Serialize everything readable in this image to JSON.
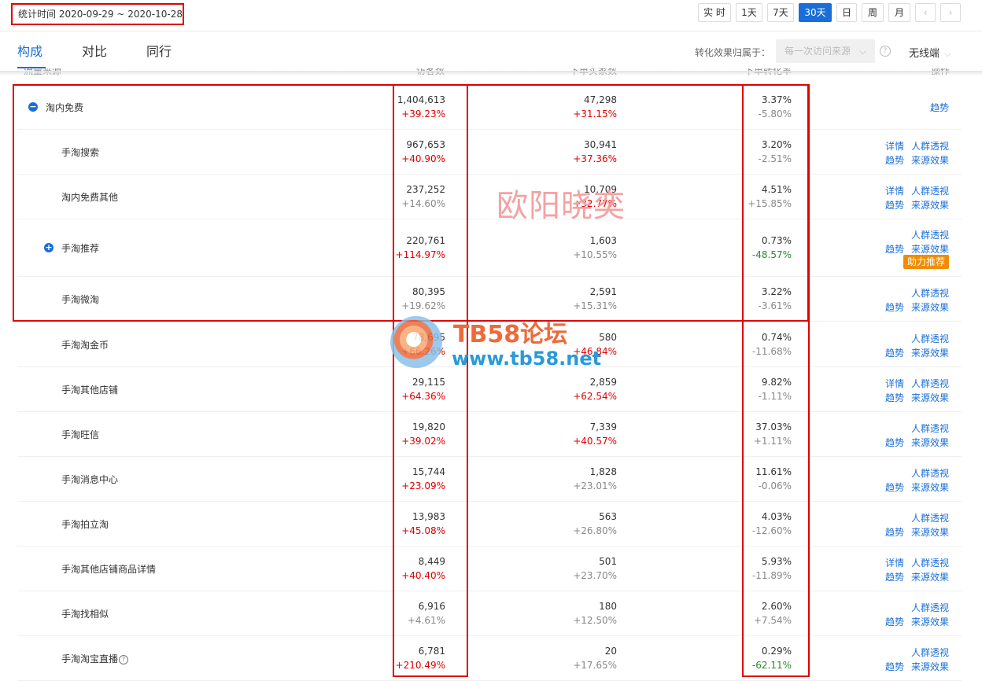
{
  "header": {
    "stat_period": "统计时间 2020-09-29 ~ 2020-10-28",
    "time_buttons": [
      "实 时",
      "1天",
      "7天",
      "30天",
      "日",
      "周",
      "月"
    ],
    "active_time_button": "30天",
    "prev_arrow": "‹",
    "next_arrow": "›"
  },
  "tabs": [
    "构成",
    "对比",
    "同行"
  ],
  "active_tab": "构成",
  "attribution": {
    "label": "转化效果归属于：",
    "select_value": "每一次访问来源",
    "help": "?"
  },
  "device": {
    "value": "无线端"
  },
  "column_headers_partial": [
    "流量来源",
    "访客数",
    "下单买家数",
    "下单转化率",
    "操作"
  ],
  "rows": [
    {
      "name": "淘内免费",
      "visitors": "1,404,613",
      "visitors_change": "+39.23%",
      "buyers": "47,298",
      "buyers_change": "+31.15%",
      "rate": "3.37%",
      "rate_change": "-5.80%",
      "toggle": "−",
      "links": [
        "趋势"
      ]
    },
    {
      "name": "手淘搜索",
      "visitors": "967,653",
      "visitors_change": "+40.90%",
      "buyers": "30,941",
      "buyers_change": "+37.36%",
      "rate": "3.20%",
      "rate_change": "-2.51%",
      "links": [
        "详情",
        "人群透视",
        "趋势",
        "来源效果"
      ]
    },
    {
      "name": "淘内免费其他",
      "visitors": "237,252",
      "visitors_change": "+14.60%",
      "buyers": "10,709",
      "buyers_change": "+32.77%",
      "rate": "4.51%",
      "rate_change": "+15.85%",
      "links": [
        "详情",
        "人群透视",
        "趋势",
        "来源效果"
      ]
    },
    {
      "name": "手淘推荐",
      "visitors": "220,761",
      "visitors_change": "+114.97%",
      "buyers": "1,603",
      "buyers_change": "+10.55%",
      "rate": "0.73%",
      "rate_change": "-48.57%",
      "toggle": "+",
      "links": [
        "人群透视",
        "趋势",
        "来源效果"
      ],
      "badge": "助力推荐"
    },
    {
      "name": "手淘微淘",
      "visitors": "80,395",
      "visitors_change": "+19.62%",
      "buyers": "2,591",
      "buyers_change": "+15.31%",
      "rate": "3.22%",
      "rate_change": "-3.61%",
      "links": [
        "人群透视",
        "趋势",
        "来源效果"
      ]
    },
    {
      "name": "手淘淘金币",
      "visitors": "78,695",
      "visitors_change": "+66.26%",
      "buyers": "580",
      "buyers_change": "+46.84%",
      "rate": "0.74%",
      "rate_change": "-11.68%",
      "links": [
        "人群透视",
        "趋势",
        "来源效果"
      ]
    },
    {
      "name": "手淘其他店铺",
      "visitors": "29,115",
      "visitors_change": "+64.36%",
      "buyers": "2,859",
      "buyers_change": "+62.54%",
      "rate": "9.82%",
      "rate_change": "-1.11%",
      "links": [
        "详情",
        "人群透视",
        "趋势",
        "来源效果"
      ]
    },
    {
      "name": "手淘旺信",
      "visitors": "19,820",
      "visitors_change": "+39.02%",
      "buyers": "7,339",
      "buyers_change": "+40.57%",
      "rate": "37.03%",
      "rate_change": "+1.11%",
      "links": [
        "人群透视",
        "趋势",
        "来源效果"
      ]
    },
    {
      "name": "手淘消息中心",
      "visitors": "15,744",
      "visitors_change": "+23.09%",
      "buyers": "1,828",
      "buyers_change": "+23.01%",
      "rate": "11.61%",
      "rate_change": "-0.06%",
      "links": [
        "人群透视",
        "趋势",
        "来源效果"
      ]
    },
    {
      "name": "手淘拍立淘",
      "visitors": "13,983",
      "visitors_change": "+45.08%",
      "buyers": "563",
      "buyers_change": "+26.80%",
      "rate": "4.03%",
      "rate_change": "-12.60%",
      "links": [
        "人群透视",
        "趋势",
        "来源效果"
      ]
    },
    {
      "name": "手淘其他店铺商品详情",
      "visitors": "8,449",
      "visitors_change": "+40.40%",
      "buyers": "501",
      "buyers_change": "+23.70%",
      "rate": "5.93%",
      "rate_change": "-11.89%",
      "links": [
        "详情",
        "人群透视",
        "趋势",
        "来源效果"
      ]
    },
    {
      "name": "手淘找相似",
      "visitors": "6,916",
      "visitors_change": "+4.61%",
      "buyers": "180",
      "buyers_change": "+12.50%",
      "rate": "2.60%",
      "rate_change": "+7.54%",
      "links": [
        "人群透视",
        "趋势",
        "来源效果"
      ]
    },
    {
      "name": "手淘淘宝直播",
      "visitors": "6,781",
      "visitors_change": "+210.49%",
      "buyers": "20",
      "buyers_change": "+17.65%",
      "rate": "0.29%",
      "rate_change": "-62.11%",
      "help": "?",
      "links": [
        "人群透视",
        "趋势",
        "来源效果"
      ]
    }
  ],
  "watermarks": {
    "author": "欧阳晓奕",
    "forum": "TB58论坛",
    "site": "www.tb58.net"
  },
  "colors": {
    "accent": "#1a6ed8",
    "highlight_border": "#e00000",
    "increase": "#e00000",
    "decrease_highlight": "#2a8a2a",
    "badge": "#f08c00"
  }
}
